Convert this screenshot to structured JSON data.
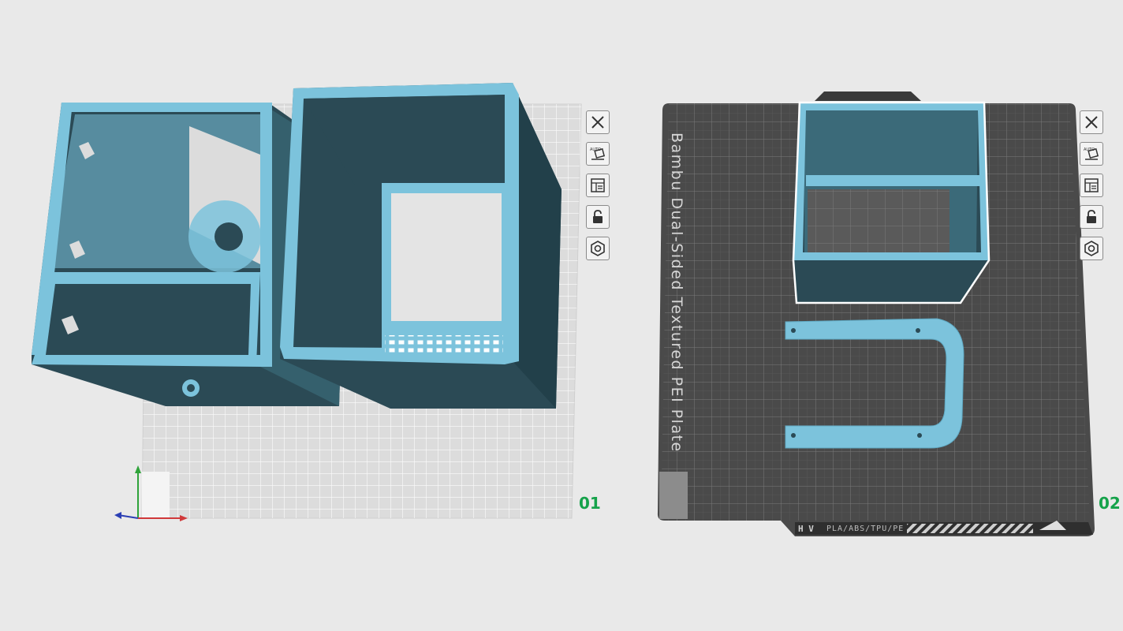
{
  "plates": [
    {
      "number": "01",
      "toolbar": [
        {
          "name": "close-icon",
          "label": "Remove plate"
        },
        {
          "name": "auto-arrange-icon",
          "label": "Arrange",
          "badge": "AUTO"
        },
        {
          "name": "layout-icon",
          "label": "Orient"
        },
        {
          "name": "unlock-icon",
          "label": "Lock plate"
        },
        {
          "name": "gear-icon",
          "label": "Plate settings"
        }
      ]
    },
    {
      "number": "02",
      "plate_label": "Bambu Dual-Sided Textured PEI Plate",
      "plate_footer": "PLA/ABS/TPU/PE",
      "toolbar": [
        {
          "name": "close-icon",
          "label": "Remove plate"
        },
        {
          "name": "auto-arrange-icon",
          "label": "Arrange",
          "badge": "AUTO"
        },
        {
          "name": "layout-icon",
          "label": "Orient"
        },
        {
          "name": "unlock-icon",
          "label": "Lock plate"
        },
        {
          "name": "gear-icon",
          "label": "Plate settings"
        }
      ]
    }
  ],
  "colors": {
    "background": "#e9e9e9",
    "model_face": "#7cc3dc",
    "model_dark": "#2b4a55",
    "plate_dark": "#4a4a4a",
    "selection": "#ffffff",
    "plate_number": "#15a24a"
  }
}
